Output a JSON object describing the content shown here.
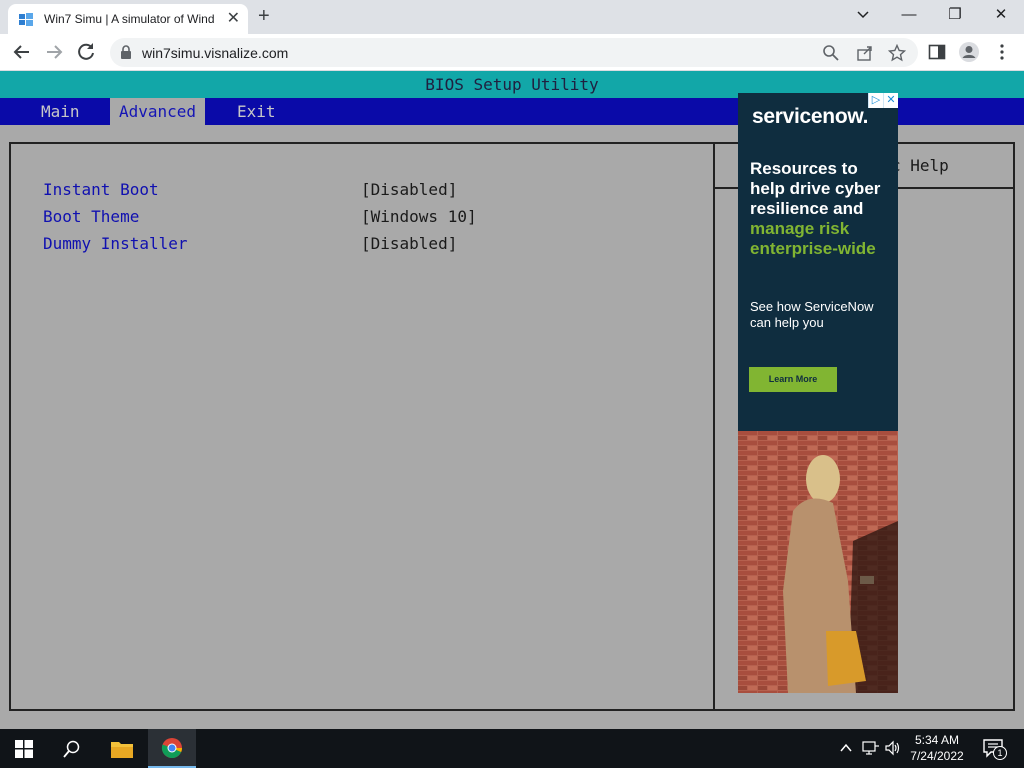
{
  "browser": {
    "tab_title": "Win7 Simu | A simulator of Wind",
    "url": "win7simu.visnalize.com",
    "new_tab_label": "+",
    "tab_close_label": "✕",
    "window_controls": {
      "minimize": "—",
      "restore": "❐",
      "close": "✕"
    }
  },
  "bios": {
    "title": "BIOS Setup Utility",
    "menu": [
      {
        "label": "Main",
        "active": false
      },
      {
        "label": "Advanced",
        "active": true
      },
      {
        "label": "Exit",
        "active": false
      }
    ],
    "settings": [
      {
        "label": "Instant Boot",
        "value": "[Disabled]"
      },
      {
        "label": "Boot Theme",
        "value": "[Windows 10]"
      },
      {
        "label": "Dummy Installer",
        "value": "[Disabled]"
      }
    ],
    "help_title": "c Help"
  },
  "ad": {
    "brand": "servicenow.",
    "headline_1": "Resources to help drive cyber resilience and",
    "headline_2": "manage risk enterprise-wide",
    "sub": "See how ServiceNow can help you",
    "cta": "Learn More",
    "colors": {
      "background": "#0f2d3f",
      "accent": "#81b532"
    }
  },
  "taskbar": {
    "time": "5:34 AM",
    "date": "7/24/2022",
    "notification_count": "1"
  }
}
